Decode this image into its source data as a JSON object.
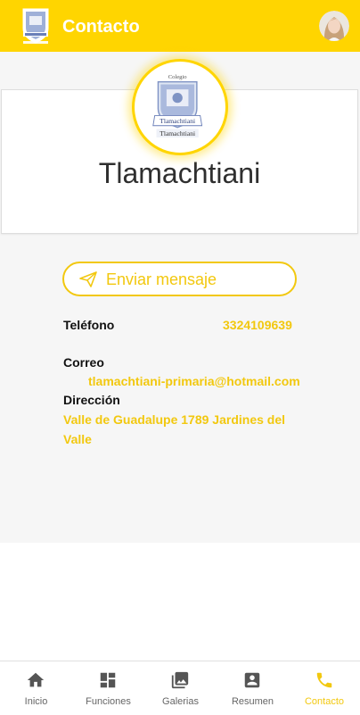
{
  "appbar": {
    "title": "Contacto",
    "logo_icon": "school-crest-icon",
    "avatar_icon": "user-avatar"
  },
  "card": {
    "crest_icon": "school-crest-icon",
    "crest_text_top": "Colegio",
    "crest_text_bottom": "Tlamachtiani",
    "school_name": "Tlamachtiani"
  },
  "send_button": {
    "label": "Enviar mensaje",
    "icon": "paper-plane-icon"
  },
  "contact": {
    "phone_label": "Teléfono",
    "phone_value": "3324109639",
    "email_label": "Correo",
    "email_value": "tlamachtiani-primaria@hotmail.com",
    "address_label": "Dirección",
    "address_line1": "Valle de Guadalupe 1789 Jardines del",
    "address_line2": "Valle"
  },
  "nav": {
    "items": [
      {
        "label": "Inicio",
        "icon": "home-icon"
      },
      {
        "label": "Funciones",
        "icon": "dashboard-icon"
      },
      {
        "label": "Galerias",
        "icon": "photo-icon"
      },
      {
        "label": "Resumen",
        "icon": "contact-card-icon"
      },
      {
        "label": "Contacto",
        "icon": "phone-icon"
      }
    ],
    "active_index": 4
  },
  "colors": {
    "primary": "#FFD500",
    "accent_text": "#F2C80F",
    "background": "#f6f6f6"
  }
}
